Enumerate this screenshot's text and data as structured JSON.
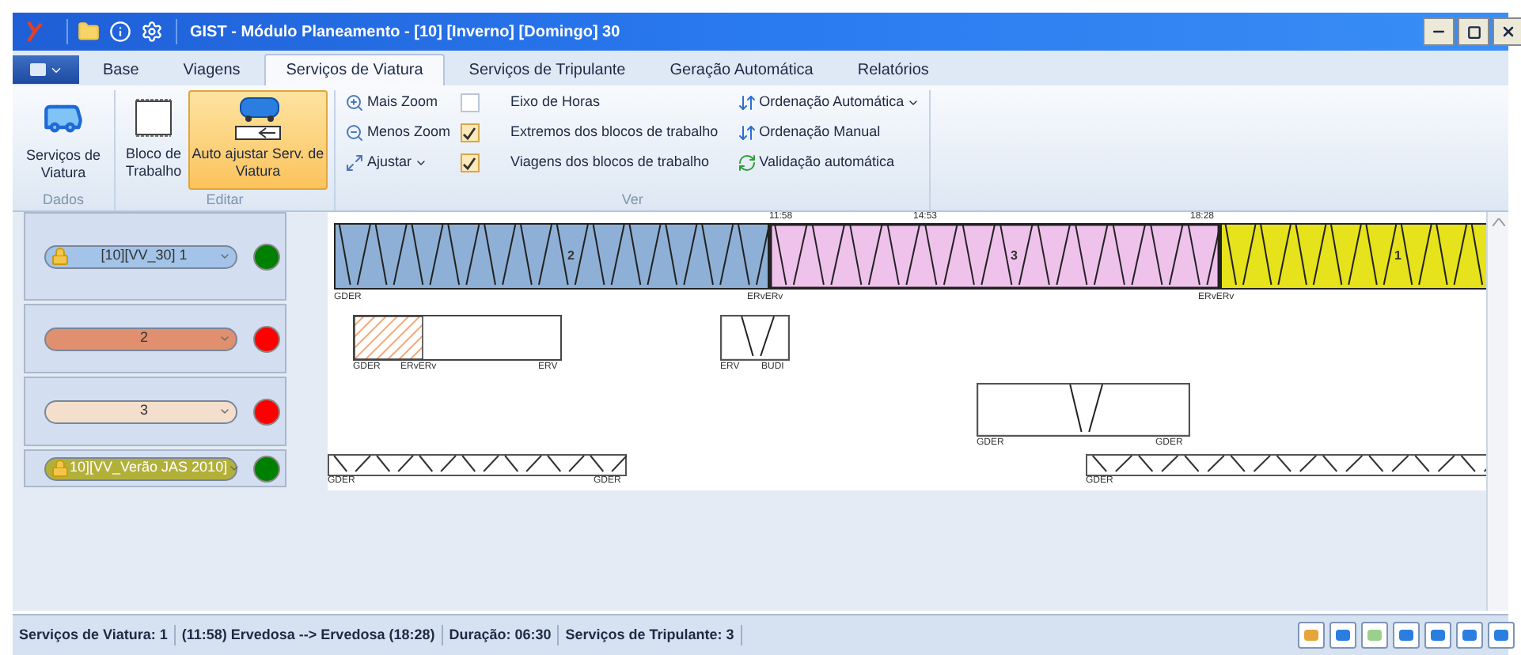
{
  "window": {
    "title": "GIST - Módulo Planeamento - [10] [Inverno] [Domingo] 30"
  },
  "tabs": [
    {
      "label": "Base",
      "selected": false
    },
    {
      "label": "Viagens",
      "selected": false
    },
    {
      "label": "Serviços de Viatura",
      "selected": true
    },
    {
      "label": "Serviços de Tripulante",
      "selected": false
    },
    {
      "label": "Geração Automática",
      "selected": false
    },
    {
      "label": "Relatórios",
      "selected": false
    }
  ],
  "ribbon": {
    "dados": {
      "label": "Dados",
      "buttons": [
        {
          "label": "Serviços de Viatura",
          "selected": false
        }
      ]
    },
    "editar": {
      "label": "Editar",
      "buttons": [
        {
          "label": "Bloco de Trabalho",
          "selected": false
        },
        {
          "label": "Auto ajustar Serv. de Viatura",
          "selected": true
        }
      ]
    },
    "ver": {
      "label": "Ver",
      "zoom_buttons": [
        {
          "label": "Mais Zoom",
          "dropdown": false
        },
        {
          "label": "Menos Zoom",
          "dropdown": false
        },
        {
          "label": "Ajustar",
          "dropdown": true
        }
      ],
      "options": [
        {
          "label": "Eixo de Horas",
          "checked": false
        },
        {
          "label": "Extremos dos blocos de trabalho",
          "checked": true
        },
        {
          "label": "Viagens dos blocos de trabalho",
          "checked": true
        }
      ],
      "ordering": [
        {
          "label": "Ordenação Automática",
          "dropdown": true
        },
        {
          "label": "Ordenação Manual",
          "dropdown": false
        },
        {
          "label": "Validação automática",
          "dropdown": false
        }
      ]
    }
  },
  "timeline": {
    "time_marks": [
      "11:58",
      "14:53",
      "18:28"
    ],
    "rows": [
      {
        "label": "[10][VV_30] 1",
        "color": "#a3c4e8",
        "locked": true,
        "status": {
          "color": "#008000"
        },
        "blocks": [
          {
            "kind": "solid",
            "label": "2",
            "color": "#8fb0d6",
            "selected": false,
            "stop_labels": [
              "GDER"
            ]
          },
          {
            "kind": "solid",
            "label": "3",
            "color": "#efc2ec",
            "selected": true,
            "stop_labels": [
              "ERvERv"
            ]
          },
          {
            "kind": "solid",
            "label": "1",
            "color": "#e6e21c",
            "selected": false,
            "stop_labels": [
              "ERvERv"
            ]
          }
        ]
      },
      {
        "label": "2",
        "color": "#e0906e",
        "locked": false,
        "status": {
          "color": "#ff0000"
        },
        "blocks": [
          {
            "kind": "split",
            "color": "#f5a877",
            "selected": false,
            "stop_labels": [
              "GDER",
              "ERvERv",
              "ERV"
            ]
          },
          {
            "kind": "trip",
            "selected": false,
            "stop_labels": [
              "ERV",
              "BUDI"
            ]
          }
        ]
      },
      {
        "label": "3",
        "color": "#f3dfcc",
        "locked": false,
        "status": {
          "color": "#ff0000"
        },
        "blocks": [
          {
            "kind": "trip",
            "selected": false,
            "stop_labels": [
              "GDER",
              "GDER"
            ]
          }
        ]
      },
      {
        "label": "10][VV_Verão JAS 2010]",
        "color": "#b3b03a",
        "locked": true,
        "status": {
          "color": "#008000"
        },
        "blocks": [
          {
            "kind": "zigzag",
            "selected": false,
            "stop_labels": [
              "GDER",
              "GDER"
            ]
          },
          {
            "kind": "zigzag",
            "selected": false,
            "stop_labels": [
              "GDER"
            ]
          }
        ]
      }
    ]
  },
  "status_bar": [
    "Serviços de Viatura: 1",
    "(11:58) Ervedosa --> Ervedosa (18:28)",
    "Duração: 06:30",
    "Serviços de Tripulante: 3"
  ]
}
